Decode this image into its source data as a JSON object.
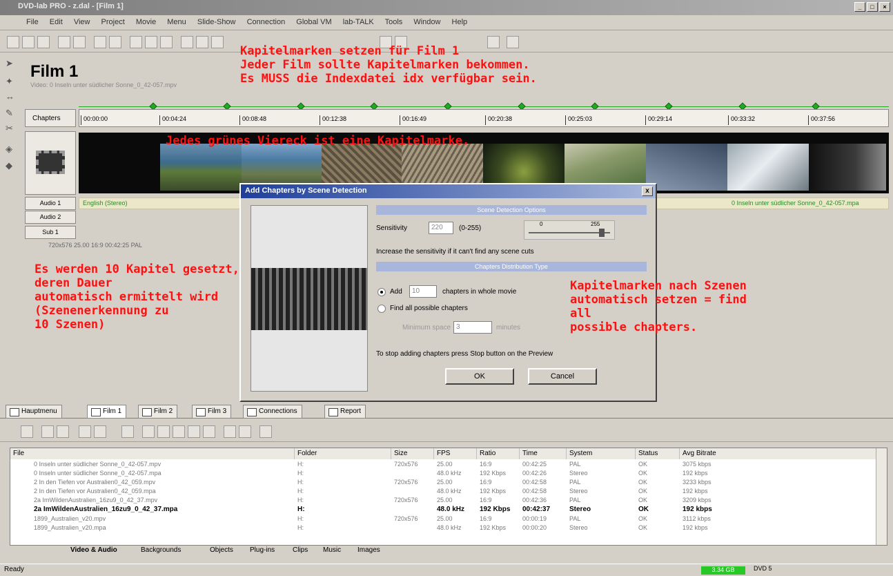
{
  "window": {
    "title": "DVD-lab PRO - z.dal - [Film 1]"
  },
  "menu": [
    "File",
    "Edit",
    "View",
    "Project",
    "Movie",
    "Menu",
    "Slide-Show",
    "Connection",
    "Global VM",
    "lab-TALK",
    "Tools",
    "Window",
    "Help"
  ],
  "film": {
    "title": "Film 1",
    "video": "Video: 0 Inseln unter südlicher Sonne_0_42-057.mpv"
  },
  "timeline": {
    "chapters_label": "Chapters",
    "ticks": [
      "00:00:00",
      "00:04:24",
      "00:08:48",
      "00:12:38",
      "00:16:49",
      "00:20:38",
      "00:25:03",
      "00:29:14",
      "00:33:32",
      "00:37:56"
    ],
    "audio1_label": "Audio 1",
    "audio2_label": "Audio 2",
    "sub_label": "Sub 1",
    "audio1_track": "English (Stereo)",
    "audio1_file": "0 Inseln unter südlicher Sonne_0_42-057.mpa",
    "info": "720x576   25.00   16:9   00:42:25   PAL"
  },
  "annotations": {
    "top": "Kapitelmarken setzen für Film 1\nJeder Film sollte Kapitelmarken bekommen.\nEs MUSS die Indexdatei idx verfügbar sein.",
    "strip": "Jedes grünes Viereck ist eine Kapitelmarke.",
    "left": "Es werden 10 Kapitel gesetzt,\nderen Dauer\nautomatisch ermittelt wird\n(Szenenerkennung zu\n10 Szenen)",
    "right": "Kapitelmarken nach Szenen\nautomatisch setzen = find\nall\npossible chapters."
  },
  "dialog": {
    "title": "Add Chapters by Scene Detection",
    "close": "x",
    "section1": "Scene Detection Options",
    "sensitivity_label": "Sensitivity",
    "sensitivity_value": "220",
    "sensitivity_range": "(0-255)",
    "slider_min": "0",
    "slider_max": "255",
    "hint": "Increase the sensitivity if it can't find any scene cuts",
    "section2": "Chapters Distribution Type",
    "add_label": "Add",
    "add_value": "10",
    "add_suffix": "chapters in whole movie",
    "findall_label": "Find all possible chapters",
    "minspace_label": "Minimum space",
    "minspace_value": "3",
    "minspace_unit": "minutes",
    "stop_hint": "To stop adding chapters press Stop button on the Preview",
    "ok": "OK",
    "cancel": "Cancel"
  },
  "tabs": [
    "Hauptmenu",
    "Film 1",
    "Film 2",
    "Film 3",
    "Connections",
    "Report"
  ],
  "table": {
    "headers": [
      "File",
      "Folder",
      "Size",
      "FPS",
      "Ratio",
      "Time",
      "System",
      "Status",
      "Avg Bitrate"
    ],
    "rows": [
      [
        "0 Inseln unter südlicher Sonne_0_42-057.mpv",
        "H:",
        "720x576",
        "25.00",
        "16:9",
        "00:42:25",
        "PAL",
        "OK",
        "3075 kbps"
      ],
      [
        "0 Inseln unter südlicher Sonne_0_42-057.mpa",
        "H:",
        "",
        "48.0 kHz",
        "192 Kbps",
        "00:42:26",
        "Stereo",
        "OK",
        "192 kbps"
      ],
      [
        "2 In den Tiefen vor Australien0_42_059.mpv",
        "H:",
        "720x576",
        "25.00",
        "16:9",
        "00:42:58",
        "PAL",
        "OK",
        "3233 kbps"
      ],
      [
        "2 In den Tiefen vor Australien0_42_059.mpa",
        "H:",
        "",
        "48.0 kHz",
        "192 Kbps",
        "00:42:58",
        "Stereo",
        "OK",
        "192 kbps"
      ],
      [
        "2a ImWildenAustralien_16zu9_0_42_37.mpv",
        "H:",
        "720x576",
        "25.00",
        "16:9",
        "00:42:36",
        "PAL",
        "OK",
        "3209 kbps"
      ],
      [
        "2a ImWildenAustralien_16zu9_0_42_37.mpa",
        "H:",
        "",
        "48.0 kHz",
        "192 Kbps",
        "00:42:37",
        "Stereo",
        "OK",
        "192 kbps"
      ],
      [
        "1899_Australien_v20.mpv",
        "H:",
        "720x576",
        "25.00",
        "16:9",
        "00:00:19",
        "PAL",
        "OK",
        "3112 kbps"
      ],
      [
        "1899_Australien_v20.mpa",
        "H:",
        "",
        "48.0 kHz",
        "192 Kbps",
        "00:00:20",
        "Stereo",
        "OK",
        "192 kbps"
      ]
    ]
  },
  "bottom_tabs": [
    "Video & Audio",
    "Backgrounds",
    "Objects",
    "Plug-ins",
    "Clips",
    "Music",
    "Images"
  ],
  "status": {
    "text": "Ready",
    "size": "3.34 GB",
    "disc": "DVD 5"
  },
  "colors": {
    "annotation": "#ff1010",
    "chapter_marker": "#22aa22",
    "dialog_title": "#1f3f9a"
  }
}
